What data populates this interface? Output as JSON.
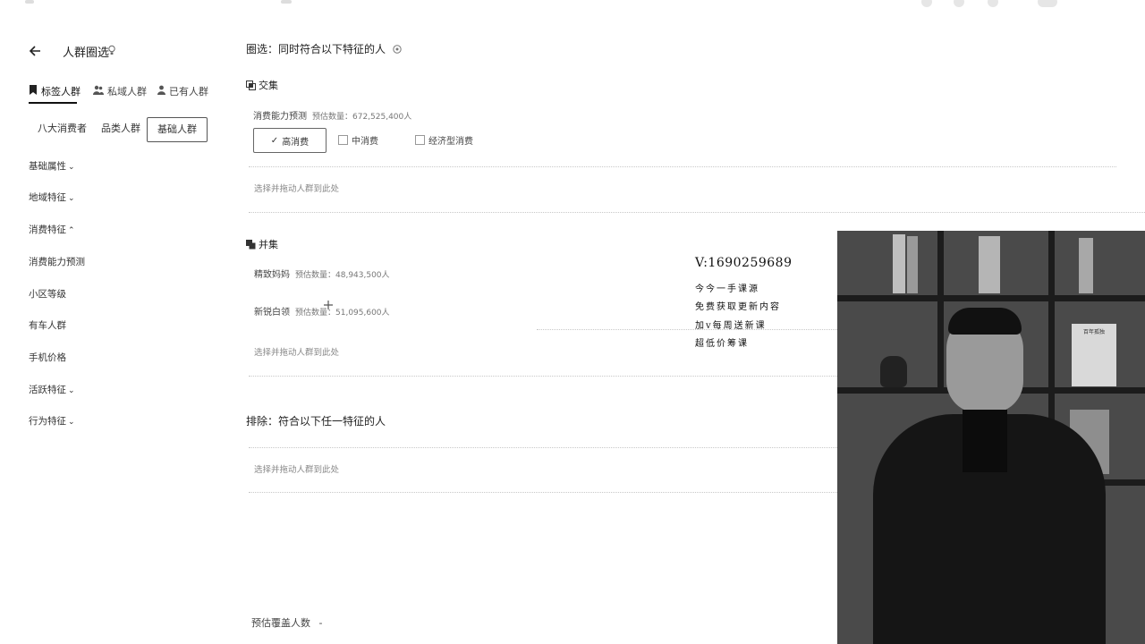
{
  "header": {
    "back_icon": "back-arrow-icon",
    "title": "人群圈选"
  },
  "left_tabs": [
    {
      "label": "标签人群",
      "icon": "bookmark-icon",
      "active": true
    },
    {
      "label": "私域人群",
      "icon": "people-icon",
      "active": false
    },
    {
      "label": "已有人群",
      "icon": "person-icon",
      "active": false
    }
  ],
  "sub_tabs": [
    "八大消费者",
    "品类人群",
    "基础人群"
  ],
  "sidebar": {
    "items": [
      {
        "label": "基础属性",
        "chevron": "⌄"
      },
      {
        "label": "地域特征",
        "chevron": "⌄"
      },
      {
        "label": "消费特征",
        "chevron": "⌃"
      },
      {
        "label": "消费能力预测",
        "chevron": ""
      },
      {
        "label": "小区等级",
        "chevron": ""
      },
      {
        "label": "有车人群",
        "chevron": ""
      },
      {
        "label": "手机价格",
        "chevron": ""
      },
      {
        "label": "活跃特征",
        "chevron": "⌄"
      },
      {
        "label": "行为特征",
        "chevron": "⌄"
      }
    ]
  },
  "main": {
    "title": "圈选：同时符合以下特征的人",
    "intersection": {
      "label": "交集",
      "feature": {
        "name": "消费能力预测",
        "estimate": "预估数量：672,525,400人"
      },
      "options": [
        {
          "label": "高消费",
          "selected": true
        },
        {
          "label": "中消费",
          "selected": false
        },
        {
          "label": "经济型消费",
          "selected": false
        }
      ],
      "drop_hint": "选择并拖动人群到此处"
    },
    "union": {
      "label": "并集",
      "features": [
        {
          "name": "精致妈妈",
          "estimate": "预估数量：48,943,500人"
        },
        {
          "name": "新锐白领",
          "estimate": "预估数量：51,095,600人"
        }
      ],
      "drop_hint": "选择并拖动人群到此处"
    },
    "exclude": {
      "title": "排除：符合以下任一特征的人",
      "drop_hint": "选择并拖动人群到此处"
    },
    "footer": {
      "estimate_label": "预估覆盖人数",
      "value": "-"
    }
  },
  "overlay": {
    "contact": "V:1690259689",
    "lines": [
      "今今一手课源",
      "免费获取更新内容",
      "加v每周送新课",
      "超低价筹课"
    ],
    "video_shelf_book_title": "百年孤独"
  }
}
